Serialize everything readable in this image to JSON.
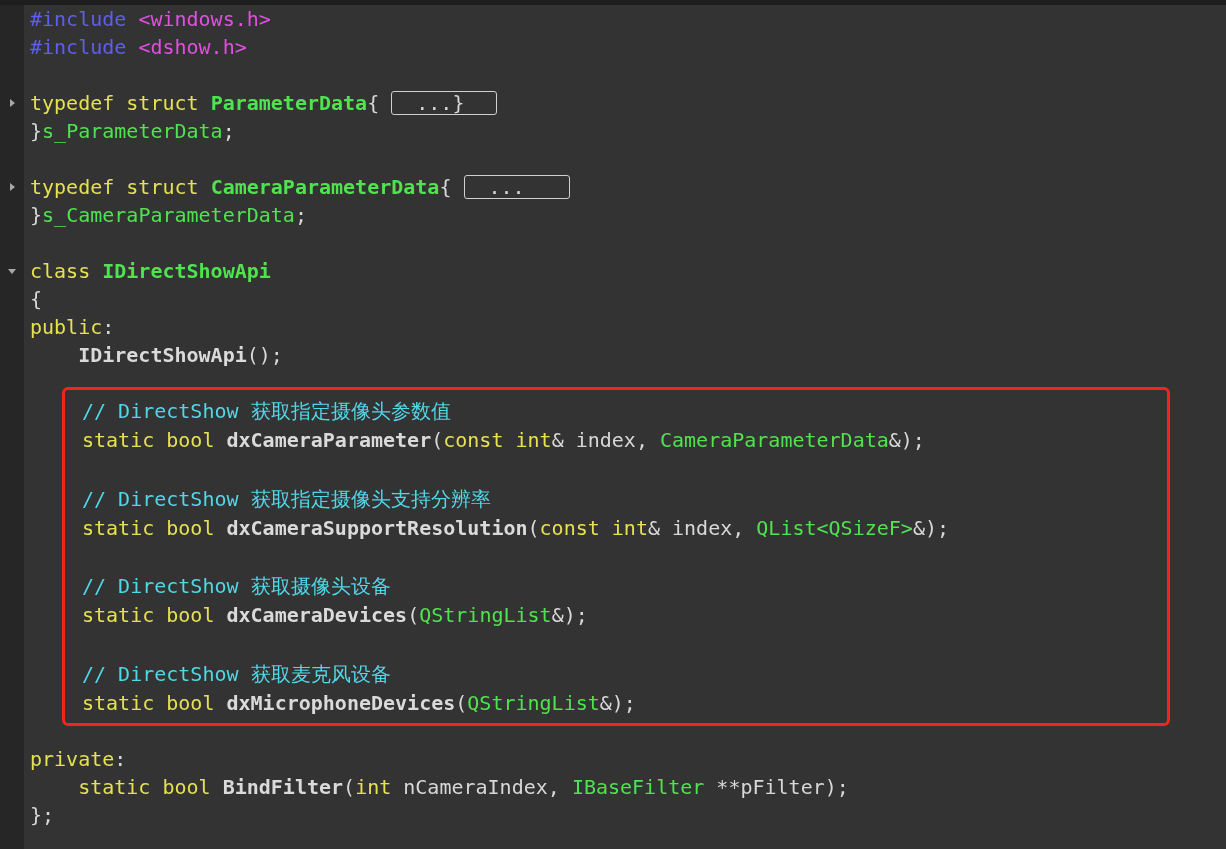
{
  "editor": {
    "blocks": [
      {
        "kind": "plain",
        "lines": [
          {
            "kind": "code",
            "tokens": [
              {
                "text": "#include ",
                "kind": "directive"
              },
              {
                "text": "<windows.h>",
                "kind": "path"
              }
            ]
          },
          {
            "kind": "code",
            "tokens": [
              {
                "text": "#include ",
                "kind": "directive"
              },
              {
                "text": "<dshow.h>",
                "kind": "path"
              }
            ]
          },
          {
            "kind": "blank"
          },
          {
            "kind": "code",
            "fold": {
              "expanded": false
            },
            "tokens": [
              {
                "text": "typedef struct ",
                "kind": "keyword"
              },
              {
                "text": "ParameterData",
                "kind": "type-name"
              },
              {
                "text": "{ ",
                "kind": "punct"
              },
              {
                "text": "...}",
                "kind": "fold-placeholder"
              }
            ]
          },
          {
            "kind": "code",
            "tokens": [
              {
                "text": "}",
                "kind": "punct"
              },
              {
                "text": "s_ParameterData",
                "kind": "type"
              },
              {
                "text": ";",
                "kind": "punct"
              }
            ]
          },
          {
            "kind": "blank"
          },
          {
            "kind": "code",
            "fold": {
              "expanded": false
            },
            "tokens": [
              {
                "text": "typedef struct ",
                "kind": "keyword"
              },
              {
                "text": "CameraParameterData",
                "kind": "type-name"
              },
              {
                "text": "{ ",
                "kind": "punct"
              },
              {
                "text": "...",
                "kind": "fold-placeholder"
              }
            ]
          },
          {
            "kind": "code",
            "tokens": [
              {
                "text": "}",
                "kind": "punct"
              },
              {
                "text": "s_CameraParameterData",
                "kind": "type"
              },
              {
                "text": ";",
                "kind": "punct"
              }
            ]
          },
          {
            "kind": "blank"
          },
          {
            "kind": "code",
            "fold": {
              "expanded": true
            },
            "tokens": [
              {
                "text": "class ",
                "kind": "keyword"
              },
              {
                "text": "IDirectShowApi",
                "kind": "type-name"
              }
            ]
          },
          {
            "kind": "code",
            "tokens": [
              {
                "text": "{",
                "kind": "punct"
              }
            ]
          },
          {
            "kind": "code",
            "tokens": [
              {
                "text": "public",
                "kind": "keyword"
              },
              {
                "text": ":",
                "kind": "punct"
              }
            ]
          },
          {
            "kind": "code",
            "tokens": [
              {
                "text": "    IDirectShowApi",
                "kind": "function"
              },
              {
                "text": "();",
                "kind": "punct"
              }
            ]
          }
        ]
      },
      {
        "kind": "marked",
        "lines": [
          {
            "kind": "code",
            "tokens": [
              {
                "text": "// DirectShow 获取指定摄像头参数值",
                "kind": "comment"
              }
            ]
          },
          {
            "kind": "code",
            "tokens": [
              {
                "text": "static bool ",
                "kind": "keyword"
              },
              {
                "text": "dxCameraParameter",
                "kind": "function"
              },
              {
                "text": "(",
                "kind": "punct"
              },
              {
                "text": "const int",
                "kind": "keyword"
              },
              {
                "text": "& index, ",
                "kind": "plain"
              },
              {
                "text": "CameraParameterData",
                "kind": "type"
              },
              {
                "text": "&);",
                "kind": "punct"
              }
            ]
          },
          {
            "kind": "blank"
          },
          {
            "kind": "code",
            "tokens": [
              {
                "text": "// DirectShow 获取指定摄像头支持分辨率",
                "kind": "comment"
              }
            ]
          },
          {
            "kind": "code",
            "tokens": [
              {
                "text": "static bool ",
                "kind": "keyword"
              },
              {
                "text": "dxCameraSupportResolution",
                "kind": "function"
              },
              {
                "text": "(",
                "kind": "punct"
              },
              {
                "text": "const int",
                "kind": "keyword"
              },
              {
                "text": "& index, ",
                "kind": "plain"
              },
              {
                "text": "QList<QSizeF>",
                "kind": "type"
              },
              {
                "text": "&);",
                "kind": "punct"
              }
            ]
          },
          {
            "kind": "blank"
          },
          {
            "kind": "code",
            "tokens": [
              {
                "text": "// DirectShow 获取摄像头设备",
                "kind": "comment"
              }
            ]
          },
          {
            "kind": "code",
            "tokens": [
              {
                "text": "static bool ",
                "kind": "keyword"
              },
              {
                "text": "dxCameraDevices",
                "kind": "function"
              },
              {
                "text": "(",
                "kind": "punct"
              },
              {
                "text": "QStringList",
                "kind": "type"
              },
              {
                "text": "&);",
                "kind": "punct"
              }
            ]
          },
          {
            "kind": "blank"
          },
          {
            "kind": "code",
            "tokens": [
              {
                "text": "// DirectShow 获取麦克风设备",
                "kind": "comment"
              }
            ]
          },
          {
            "kind": "code",
            "tokens": [
              {
                "text": "static bool ",
                "kind": "keyword"
              },
              {
                "text": "dxMicrophoneDevices",
                "kind": "function"
              },
              {
                "text": "(",
                "kind": "punct"
              },
              {
                "text": "QStringList",
                "kind": "type"
              },
              {
                "text": "&);",
                "kind": "punct"
              }
            ]
          }
        ]
      },
      {
        "kind": "plain",
        "lines": [
          {
            "kind": "code",
            "tokens": [
              {
                "text": "private",
                "kind": "keyword"
              },
              {
                "text": ":",
                "kind": "punct"
              }
            ]
          },
          {
            "kind": "code",
            "tokens": [
              {
                "text": "    static bool ",
                "kind": "keyword"
              },
              {
                "text": "BindFilter",
                "kind": "function"
              },
              {
                "text": "(",
                "kind": "punct"
              },
              {
                "text": "int",
                "kind": "keyword"
              },
              {
                "text": " nCameraIndex, ",
                "kind": "plain"
              },
              {
                "text": "IBaseFilter",
                "kind": "type"
              },
              {
                "text": " **pFilter);",
                "kind": "plain"
              }
            ]
          },
          {
            "kind": "code",
            "tokens": [
              {
                "text": "};",
                "kind": "punct"
              }
            ]
          }
        ]
      }
    ]
  }
}
